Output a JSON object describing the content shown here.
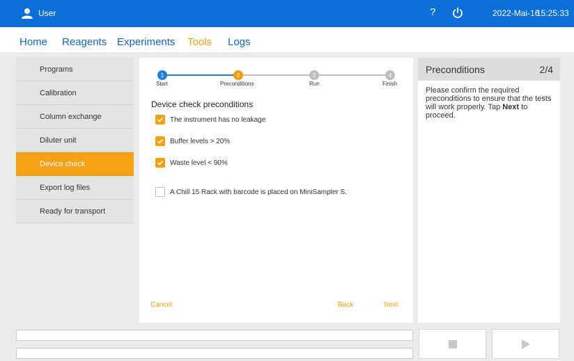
{
  "header": {
    "user_label": "User",
    "help_glyph": "?",
    "date": "2022-Mai-16",
    "time": "15:25:33",
    "brand_color": "#0b6fd9"
  },
  "menu": {
    "home": "Home",
    "reagents": "Reagents",
    "experiments": "Experiments",
    "tools": "Tools",
    "logs": "Logs",
    "active": "Tools"
  },
  "sidebar": {
    "items": [
      {
        "label": "Programs"
      },
      {
        "label": "Calibration"
      },
      {
        "label": "Column exchange"
      },
      {
        "label": "Diluter unit"
      },
      {
        "label": "Device check"
      },
      {
        "label": "Export log files"
      },
      {
        "label": "Ready for transport"
      }
    ],
    "active": "Device check"
  },
  "stepper": {
    "steps": [
      {
        "num": "1",
        "label": "Start",
        "state": "done"
      },
      {
        "num": "2",
        "label": "Preconditions",
        "state": "current"
      },
      {
        "num": "3",
        "label": "Run",
        "state": "pending"
      },
      {
        "num": "4",
        "label": "Finish",
        "state": "pending"
      }
    ]
  },
  "main": {
    "heading": "Device check preconditions",
    "checks": [
      {
        "label": "The instrument has no leakage",
        "checked": true
      },
      {
        "label": "Buffer levels > 20%",
        "checked": true
      },
      {
        "label": "Waste level < 90%",
        "checked": true
      },
      {
        "label": "A Chill 15 Rack with barcode is placed on MiniSampler S.",
        "checked": false
      }
    ],
    "cancel": "Cancel",
    "back": "Back",
    "next": "Next",
    "accent_color": "#f59c0c"
  },
  "info": {
    "title": "Preconditions",
    "page": "2/4",
    "text_before": "Please confirm the required preconditions to ensure that the tests will work properly. Tap ",
    "text_bold": "Next",
    "text_after": " to proceed."
  },
  "controls": {
    "stop_icon": "stop-icon",
    "play_icon": "play-icon"
  }
}
